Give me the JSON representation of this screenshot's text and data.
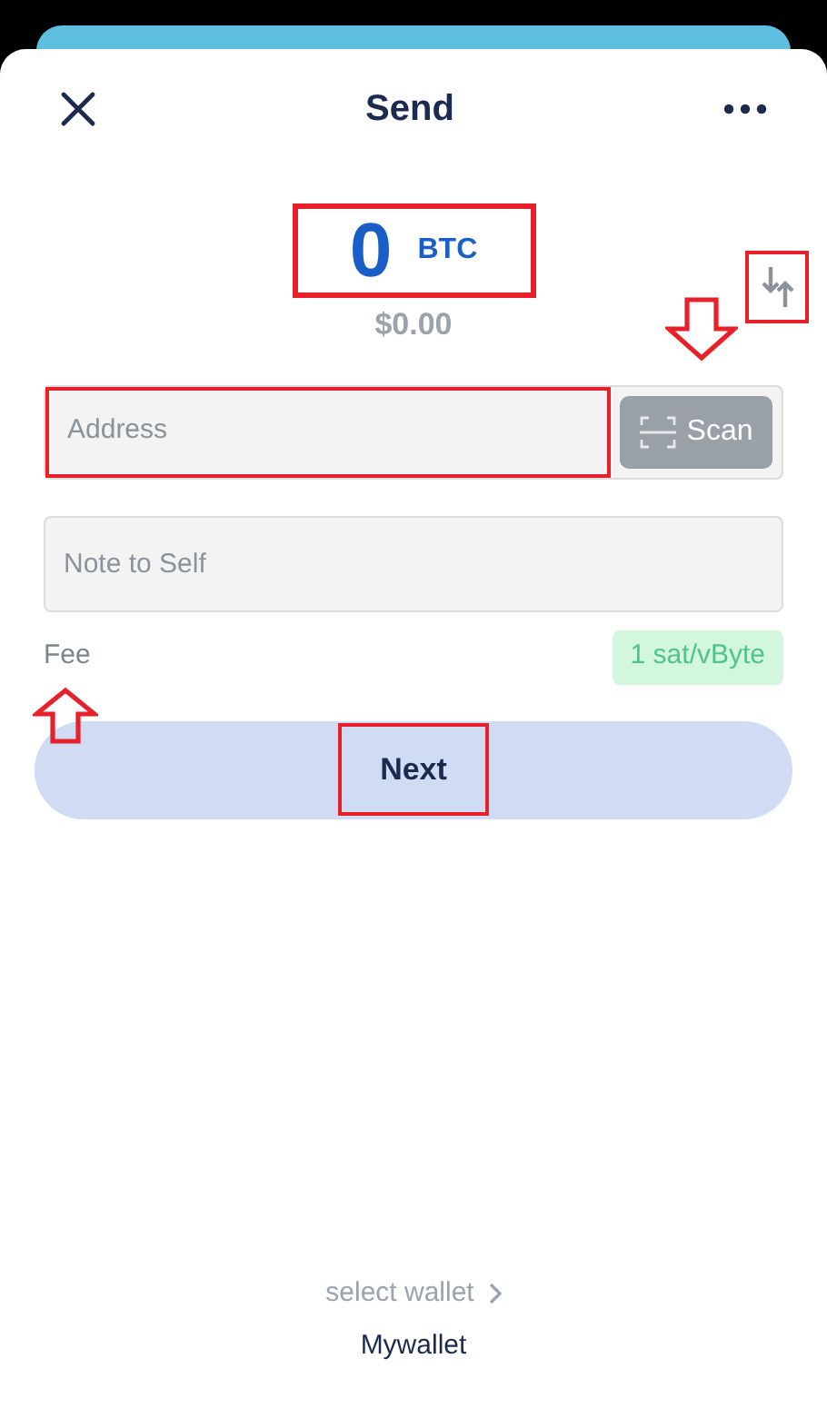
{
  "header": {
    "title": "Send"
  },
  "amount": {
    "value": "0",
    "unit": "BTC",
    "fiat": "$0.00",
    "highlighted": true
  },
  "swap_button": {
    "highlighted": true
  },
  "address": {
    "placeholder": "Address",
    "highlighted": true
  },
  "scan_button": {
    "label": "Scan",
    "pointed_at": true
  },
  "note": {
    "placeholder": "Note to Self"
  },
  "fee": {
    "label": "Fee",
    "value": "1 sat/vByte",
    "pointed_at": true
  },
  "next_button": {
    "label": "Next",
    "highlighted": true
  },
  "wallet": {
    "label": "select wallet",
    "name": "Mywallet"
  }
}
